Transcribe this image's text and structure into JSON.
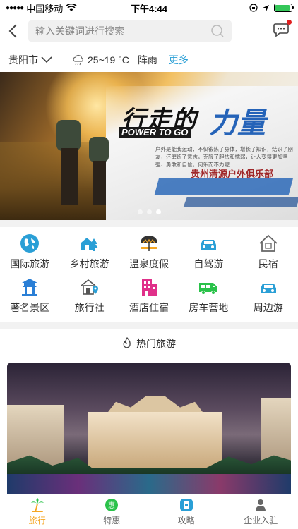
{
  "statusbar": {
    "carrier": "中国移动",
    "time": "下午4:44",
    "battery_level": 0.9
  },
  "search": {
    "placeholder": "输入关键词进行搜索"
  },
  "weather": {
    "city": "贵阳市",
    "temperature": "25~19 °C",
    "condition": "阵雨",
    "more_label": "更多"
  },
  "banner": {
    "title_part1": "行走的",
    "title_part2": "力量",
    "subtitle": "POWER TO GO",
    "body_text": "户外是能我运动，不仅锻炼了身体，增长了知识，结识了朋友，还磨炼了意志，克服了胆怯和懦弱，让人变得更加坚强、勇敢和自信。何乐而不为呢",
    "org": "贵州清源户外俱乐部",
    "page_count": 3,
    "active_page": 3
  },
  "categories": [
    {
      "label": "国际旅游",
      "icon": "globe-icon",
      "color": "#2a9fd6"
    },
    {
      "label": "乡村旅游",
      "icon": "village-icon",
      "color": "#2a9fd6"
    },
    {
      "label": "温泉度假",
      "icon": "umbrella-icon",
      "color": "#f5a623"
    },
    {
      "label": "自驾游",
      "icon": "car-icon",
      "color": "#2a9fd6"
    },
    {
      "label": "民宿",
      "icon": "house-icon",
      "color": "#666666"
    },
    {
      "label": "著名景区",
      "icon": "pavilion-icon",
      "color": "#2a7fd6"
    },
    {
      "label": "旅行社",
      "icon": "travel-agency-icon",
      "color": "#2a9fd6"
    },
    {
      "label": "酒店住宿",
      "icon": "hotel-icon",
      "color": "#e0308a"
    },
    {
      "label": "房车营地",
      "icon": "rv-icon",
      "color": "#2ac24a"
    },
    {
      "label": "周边游",
      "icon": "car-icon",
      "color": "#2a9fd6"
    }
  ],
  "hot": {
    "title": "热门旅游"
  },
  "tabs": [
    {
      "label": "旅行",
      "icon": "palm-tree-icon",
      "active": true
    },
    {
      "label": "特惠",
      "icon": "discount-icon",
      "active": false
    },
    {
      "label": "攻略",
      "icon": "guide-icon",
      "active": false
    },
    {
      "label": "企业入驻",
      "icon": "user-icon",
      "active": false
    }
  ],
  "colors": {
    "accent": "#2a9fd6",
    "active_tab": "#f5a623"
  }
}
